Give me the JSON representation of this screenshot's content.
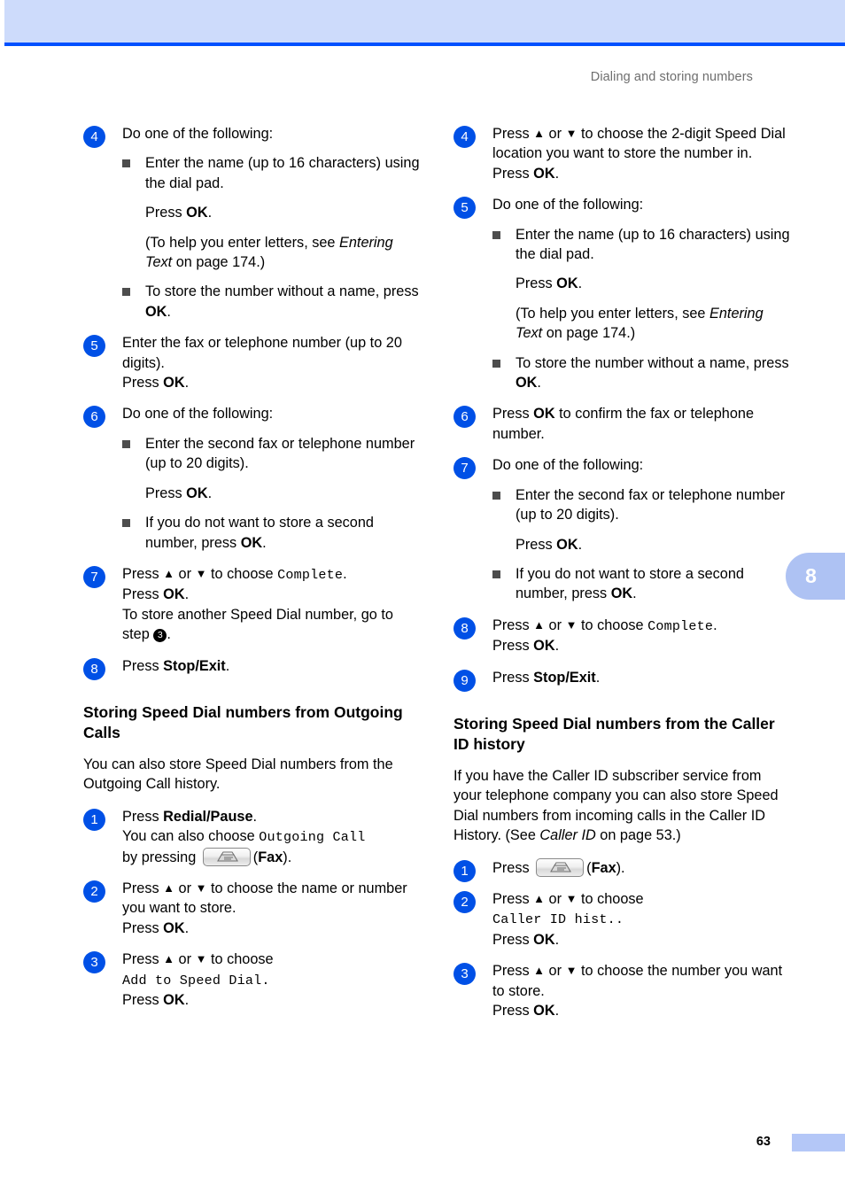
{
  "header": {
    "running_title": "Dialing and storing numbers"
  },
  "chapter_tab": {
    "number": "8"
  },
  "footer": {
    "page_number": "63"
  },
  "icons": {
    "fax_key": "fax-machine-key-icon"
  },
  "left_column": {
    "steps": [
      {
        "num": "4",
        "lead": "Do one of the following:",
        "bullets": [
          {
            "text": "Enter the name (up to 16 characters) using the dial pad.",
            "sub1_pre": "Press ",
            "sub1_bold": "OK",
            "sub1_post": ".",
            "sub2": " (To help you enter letters, see ",
            "sub2_ital": "Entering Text",
            "sub2_post": " on page 174.)"
          },
          {
            "text_pre": "To store the number without a name, press ",
            "text_bold": "OK",
            "text_post": "."
          }
        ]
      },
      {
        "num": "5",
        "line1": "Enter the fax or telephone number (up to 20 digits).",
        "line2_pre": "Press ",
        "line2_bold": "OK",
        "line2_post": "."
      },
      {
        "num": "6",
        "lead": "Do one of the following:",
        "bullets": [
          {
            "text": "Enter the second fax or telephone number (up to 20 digits).",
            "sub1_pre": "Press ",
            "sub1_bold": "OK",
            "sub1_post": "."
          },
          {
            "text_pre": "If you do not want to store a second number, press ",
            "text_bold": "OK",
            "text_post": "."
          }
        ]
      },
      {
        "num": "7",
        "line1_pre": "Press ",
        "line1_up": "▲",
        "line1_mid": " or ",
        "line1_down": "▼",
        "line1_to": " to  choose ",
        "line1_mono": "Complete",
        "line1_post": ".",
        "line2_pre": "Press ",
        "line2_bold": "OK",
        "line2_post": ".",
        "line3_pre": "To store another Speed Dial number, go to step ",
        "line3_circ": "3",
        "line3_post": "."
      },
      {
        "num": "8",
        "line1_pre": "Press ",
        "line1_bold": "Stop/Exit",
        "line1_post": "."
      }
    ],
    "section": {
      "heading": "Storing Speed Dial numbers from Outgoing Calls",
      "intro": "You can also store Speed Dial numbers from the Outgoing Call history.",
      "steps": [
        {
          "num": "1",
          "line1_pre": "Press ",
          "line1_bold": "Redial/Pause",
          "line1_post": ".",
          "line2_pre": "You can also choose ",
          "line2_mono": "Outgoing Call",
          "line3_pre": "by pressing ",
          "line3_paren_open": "(",
          "line3_bold": "Fax",
          "line3_paren_close": ")."
        },
        {
          "num": "2",
          "line1_pre": "Press ",
          "line1_up": "▲",
          "line1_mid": " or ",
          "line1_down": "▼",
          "line1_post": " to choose the name or number you want to store.",
          "line2_pre": "Press ",
          "line2_bold": "OK",
          "line2_post": "."
        },
        {
          "num": "3",
          "line1_pre": "Press ",
          "line1_up": "▲",
          "line1_mid": " or ",
          "line1_down": "▼",
          "line1_post": " to choose",
          "line2_mono": "Add to Speed Dial",
          "line2_post": ".",
          "line3_pre": "Press ",
          "line3_bold": "OK",
          "line3_post": "."
        }
      ]
    }
  },
  "right_column": {
    "steps": [
      {
        "num": "4",
        "line1_pre": "Press ",
        "line1_up": "▲",
        "line1_mid": " or ",
        "line1_down": "▼",
        "line1_post": " to choose the 2-digit Speed Dial location you want to store the number in.",
        "line2_pre": "Press ",
        "line2_bold": "OK",
        "line2_post": "."
      },
      {
        "num": "5",
        "lead": "Do one of the following:",
        "bullets": [
          {
            "text": "Enter the name (up to 16 characters) using the dial pad.",
            "sub1_pre": "Press ",
            "sub1_bold": "OK",
            "sub1_post": ".",
            "sub2": "(To help you enter letters, see ",
            "sub2_ital": "Entering Text",
            "sub2_post": " on page 174.)"
          },
          {
            "text_pre": "To store the number without a name, press ",
            "text_bold": "OK",
            "text_post": "."
          }
        ]
      },
      {
        "num": "6",
        "line1_pre": "Press ",
        "line1_bold": "OK",
        "line1_post": " to confirm the fax or telephone number."
      },
      {
        "num": "7",
        "lead": "Do one of the following:",
        "bullets": [
          {
            "text": "Enter the second fax or telephone number (up to 20 digits).",
            "sub1_pre": "Press ",
            "sub1_bold": "OK",
            "sub1_post": "."
          },
          {
            "text_pre": "If you do not want to store a second number, press ",
            "text_bold": "OK",
            "text_post": "."
          }
        ]
      },
      {
        "num": "8",
        "line1_pre": "Press ",
        "line1_up": "▲",
        "line1_mid": " or ",
        "line1_down": "▼",
        "line1_to": " to  choose ",
        "line1_mono": "Complete",
        "line1_post": ".",
        "line2_pre": "Press ",
        "line2_bold": "OK",
        "line2_post": "."
      },
      {
        "num": "9",
        "line1_pre": "Press ",
        "line1_bold": "Stop/Exit",
        "line1_post": "."
      }
    ],
    "section": {
      "heading": "Storing Speed Dial numbers from the Caller ID history",
      "intro_pre": "If you have the Caller ID subscriber service from your telephone company you can also store Speed Dial numbers from incoming calls in the Caller ID History. (See ",
      "intro_ital": "Caller ID",
      "intro_post": " on page 53.)",
      "steps": [
        {
          "num": "1",
          "line1_pre": "Press ",
          "line1_paren_open": "(",
          "line1_bold": "Fax",
          "line1_paren_close": ")."
        },
        {
          "num": "2",
          "line1_pre": "Press ",
          "line1_up": "▲",
          "line1_mid": " or ",
          "line1_down": "▼",
          "line1_post": " to choose",
          "line2_mono": "Caller ID hist..",
          "line3_pre": "Press ",
          "line3_bold": "OK",
          "line3_post": "."
        },
        {
          "num": "3",
          "line1_pre": "Press ",
          "line1_up": "▲",
          "line1_mid": " or ",
          "line1_down": "▼",
          "line1_post": " to choose the number you want to store.",
          "line2": "want to store.",
          "line3_pre": "Press ",
          "line3_bold": "OK",
          "line3_post": "."
        }
      ]
    }
  }
}
